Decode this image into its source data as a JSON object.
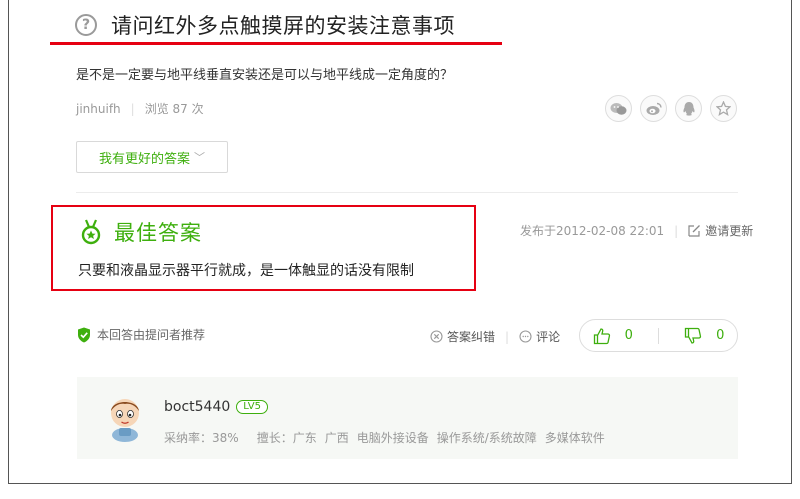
{
  "question": {
    "title": "请问红外多点触摸屏的安装注意事项",
    "description": "是不是一定要与地平线垂直安装还是可以与地平线成一定角度的？",
    "author": "jinhuifh",
    "views": "浏览 87 次"
  },
  "share": {
    "icons": [
      "wechat-icon",
      "weibo-icon",
      "qq-icon",
      "favorite-icon"
    ]
  },
  "better_answer_button": {
    "label": "我有更好的答案",
    "chevron": "﹀"
  },
  "best_answer": {
    "label": "最佳答案",
    "text": "只要和液晶显示器平行就成，是一体触显的话没有限制",
    "published": "发布于2012-02-08 22:01",
    "invite_label": "邀请更新"
  },
  "recommend": {
    "text": "本回答由提问者推荐"
  },
  "actions": {
    "correct_label": "答案纠错",
    "comment_label": "评论"
  },
  "votes": {
    "up": "0",
    "down": "0"
  },
  "answerer": {
    "name": "boct5440",
    "level": "LV5",
    "adoption_rate": "采纳率：38%",
    "expertise_label": "擅长：",
    "tags": [
      "广东",
      "广西",
      "电脑外接设备",
      "操作系统/系统故障",
      "多媒体软件"
    ]
  },
  "colors": {
    "accent_green": "#3eaf0e",
    "highlight_red": "#e60012"
  }
}
